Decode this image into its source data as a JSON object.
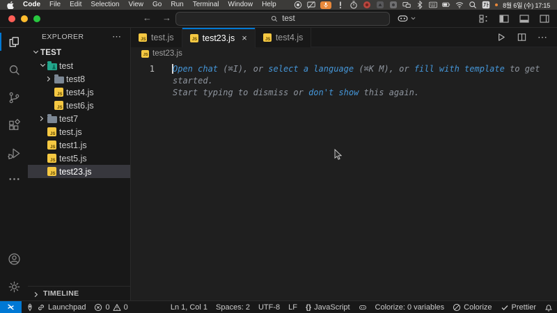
{
  "menubar": {
    "apple_icon": "apple-logo-icon",
    "items": [
      "Code",
      "File",
      "Edit",
      "Selection",
      "View",
      "Go",
      "Run",
      "Terminal",
      "Window",
      "Help"
    ],
    "status_icons": [
      "record-icon",
      "screen-mirroring-icon",
      "mic-active-icon",
      "exclamation-icon",
      "timer-icon",
      "app-red-icon",
      "app-dark-icon",
      "app-gray-icon",
      "window-icon",
      "bluetooth-icon",
      "keyboard-icon",
      "battery-icon",
      "wifi-icon",
      "spotlight-icon",
      "ime-icon",
      "notification-dot"
    ],
    "clock": "8월 6일 (수) 17:15"
  },
  "titlebar": {
    "search_value": "test",
    "search_icon": "magnifier-icon",
    "copilot_icon": "copilot-icon",
    "window_icons": [
      "customize-layout-icon",
      "toggle-primary-sidebar-icon",
      "toggle-panel-icon",
      "toggle-secondary-sidebar-icon"
    ],
    "window_controls": [
      "close",
      "minimize",
      "zoom"
    ]
  },
  "activity_bar": {
    "top": [
      {
        "name": "explorer",
        "icon": "files-icon",
        "active": true
      },
      {
        "name": "search",
        "icon": "search-icon",
        "active": false
      },
      {
        "name": "source-control",
        "icon": "source-control-icon",
        "active": false
      },
      {
        "name": "extensions",
        "icon": "extensions-icon",
        "active": false
      },
      {
        "name": "run-debug",
        "icon": "debug-icon",
        "active": false
      },
      {
        "name": "more-views",
        "icon": "ellipsis-icon",
        "active": false
      }
    ],
    "bottom": [
      {
        "name": "accounts",
        "icon": "account-icon",
        "active": false
      },
      {
        "name": "settings",
        "icon": "gear-icon",
        "active": false
      }
    ]
  },
  "explorer": {
    "title": "EXPLORER",
    "more_actions": "⋯",
    "tree": [
      {
        "label": "TEST",
        "icon": "none",
        "chevron": "expanded",
        "level": 0,
        "root": true
      },
      {
        "label": "test",
        "icon": "folder-test",
        "chevron": "expanded",
        "level": 1
      },
      {
        "label": "test8",
        "icon": "folder",
        "chevron": "collapsed",
        "level": 2
      },
      {
        "label": "test4.js",
        "icon": "js",
        "chevron": "none",
        "level": 2
      },
      {
        "label": "test6.js",
        "icon": "js",
        "chevron": "none",
        "level": 2
      },
      {
        "label": "test7",
        "icon": "folder",
        "chevron": "collapsed",
        "level": 1
      },
      {
        "label": "test.js",
        "icon": "js",
        "chevron": "none",
        "level": 1
      },
      {
        "label": "test1.js",
        "icon": "js",
        "chevron": "none",
        "level": 1
      },
      {
        "label": "test5.js",
        "icon": "js",
        "chevron": "none",
        "level": 1
      },
      {
        "label": "test23.js",
        "icon": "js",
        "chevron": "none",
        "level": 1,
        "selected": true
      }
    ],
    "timeline_label": "TIMELINE"
  },
  "editor_tabs": [
    {
      "label": "test.js",
      "icon": "js",
      "active": false
    },
    {
      "label": "test23.js",
      "icon": "js",
      "active": true,
      "close_glyph": "×"
    },
    {
      "label": "test4.js",
      "icon": "js",
      "active": false
    }
  ],
  "editor_actions": [
    "run-icon",
    "split-editor-icon",
    "more-actions-icon"
  ],
  "breadcrumb": {
    "icon": "js",
    "label": "test23.js"
  },
  "editor": {
    "line_number": "1",
    "ghost_lines": [
      [
        {
          "text": "Open chat",
          "link": true
        },
        {
          "text": " (⌘I), or ",
          "link": false
        },
        {
          "text": "select a language",
          "link": true
        },
        {
          "text": " (⌘K M), or ",
          "link": false
        },
        {
          "text": "fill with template",
          "link": true
        },
        {
          "text": " to get",
          "link": false
        }
      ],
      [
        {
          "text": "started.",
          "link": false
        }
      ],
      [
        {
          "text": "Start typing to dismiss or ",
          "link": false
        },
        {
          "text": "don't show",
          "link": true
        },
        {
          "text": " this again.",
          "link": false
        }
      ]
    ]
  },
  "status_bar": {
    "left": [
      {
        "name": "remote-indicator",
        "parts": [
          {
            "icon": "remote-icon"
          }
        ]
      },
      {
        "name": "launchpad",
        "parts": [
          {
            "icon": "rocket-icon"
          },
          {
            "icon": "link-icon"
          },
          {
            "text": "Launchpad"
          }
        ]
      },
      {
        "name": "problems",
        "parts": [
          {
            "icon": "error-icon"
          },
          {
            "text": "0"
          },
          {
            "icon": "warning-icon"
          },
          {
            "text": "0"
          }
        ]
      }
    ],
    "right": [
      {
        "name": "cursor-position",
        "parts": [
          {
            "text": "Ln 1, Col 1"
          }
        ]
      },
      {
        "name": "indentation",
        "parts": [
          {
            "text": "Spaces: 2"
          }
        ]
      },
      {
        "name": "encoding",
        "parts": [
          {
            "text": "UTF-8"
          }
        ]
      },
      {
        "name": "eol",
        "parts": [
          {
            "text": "LF"
          }
        ]
      },
      {
        "name": "language-mode",
        "parts": [
          {
            "txtic": "{}"
          },
          {
            "text": "JavaScript"
          }
        ]
      },
      {
        "name": "copilot-status",
        "parts": [
          {
            "icon": "copilot-icon"
          }
        ]
      },
      {
        "name": "colorize-variables",
        "parts": [
          {
            "text": "Colorize: 0 variables"
          }
        ]
      },
      {
        "name": "colorize",
        "parts": [
          {
            "icon": "slash-circle-icon"
          },
          {
            "text": "Colorize"
          }
        ]
      },
      {
        "name": "prettier",
        "parts": [
          {
            "icon": "check-icon"
          },
          {
            "text": "Prettier"
          }
        ]
      },
      {
        "name": "notifications",
        "parts": [
          {
            "icon": "bell-icon"
          }
        ]
      }
    ]
  },
  "colors": {
    "accent_blue": "#0078d4",
    "remote_badge": "#0078d4",
    "selection_bg": "#37373d",
    "editor_bg": "#1f1f1f",
    "chrome_bg": "#181818",
    "menubar_bg": "#3c3b39",
    "ghost_text": "#8f959e",
    "ghost_link": "#4596d8",
    "js_badge_yellow": "#f5c842",
    "folder_slate": "#7c8794",
    "folder_test_teal": "#23a68c",
    "mic_orange": "#e8883a",
    "traffic_close": "#ff5f57",
    "traffic_min": "#febc2e",
    "traffic_zoom": "#28c840"
  }
}
